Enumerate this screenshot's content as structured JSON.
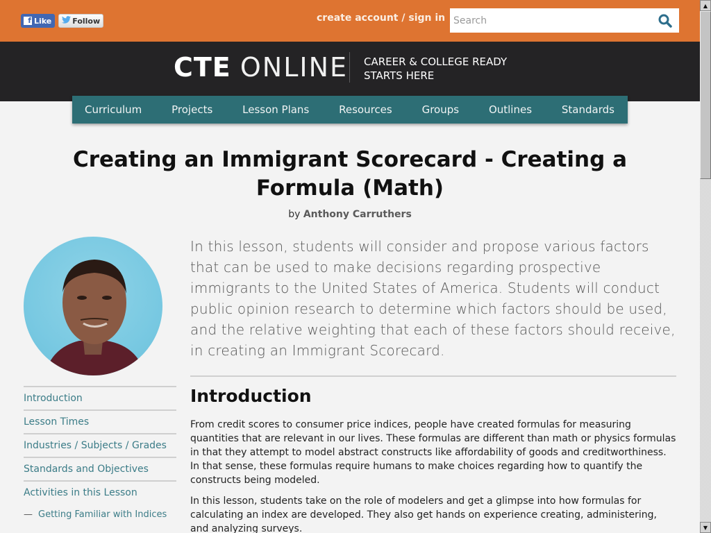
{
  "social": {
    "facebook_label": "Like",
    "twitter_label": "Follow"
  },
  "topbar": {
    "account_link": "create account / sign in",
    "search_placeholder": "Search",
    "search_value": "",
    "search_icon": "magnifier-icon"
  },
  "header": {
    "logo_bold": "CTE",
    "logo_thin": "ONLINE",
    "tagline_line1": "CAREER & COLLEGE READY",
    "tagline_line2": "STARTS HERE"
  },
  "nav": {
    "items": [
      {
        "label": "Curriculum"
      },
      {
        "label": "Projects"
      },
      {
        "label": "Lesson Plans"
      },
      {
        "label": "Resources"
      },
      {
        "label": "Groups"
      },
      {
        "label": "Outlines"
      },
      {
        "label": "Standards"
      }
    ]
  },
  "lesson": {
    "title": "Creating an Immigrant Scorecard - Creating a Formula (Math)",
    "by_label": "by",
    "author": "Anthony Carruthers",
    "summary": "In this lesson, students will consider and propose various factors that can be used to make decisions regarding prospective immigrants to the United States of America. Students will conduct public opinion research to determine which factors should be used, and the relative weighting that each of these factors should receive, in creating an Immigrant Scorecard."
  },
  "sidebar": {
    "items": [
      {
        "label": "Introduction"
      },
      {
        "label": "Lesson Times"
      },
      {
        "label": "Industries / Subjects / Grades"
      },
      {
        "label": "Standards and Objectives"
      },
      {
        "label": "Activities in this Lesson"
      }
    ],
    "subitems": [
      {
        "dash": "—",
        "label": "Getting Familiar with Indices"
      }
    ]
  },
  "content": {
    "heading": "Introduction",
    "paragraphs": [
      "From credit scores to consumer price indices, people have created formulas for measuring quantities that are relevant in our lives. These formulas are different than math or physics formulas in that they attempt to model abstract constructs like affordability of goods and creditworthiness. In that sense, these formulas require humans to make choices regarding how to quantify the constructs being modeled.",
      "In this lesson, students take on the role of modelers and get a glimpse into how formulas for calculating an index are developed. They also get hands on experience creating, administering, and analyzing surveys."
    ]
  },
  "colors": {
    "topbar": "#de7431",
    "header": "#242325",
    "nav": "#2d6e75",
    "link": "#3b7c87",
    "background": "#f3f3f3"
  }
}
